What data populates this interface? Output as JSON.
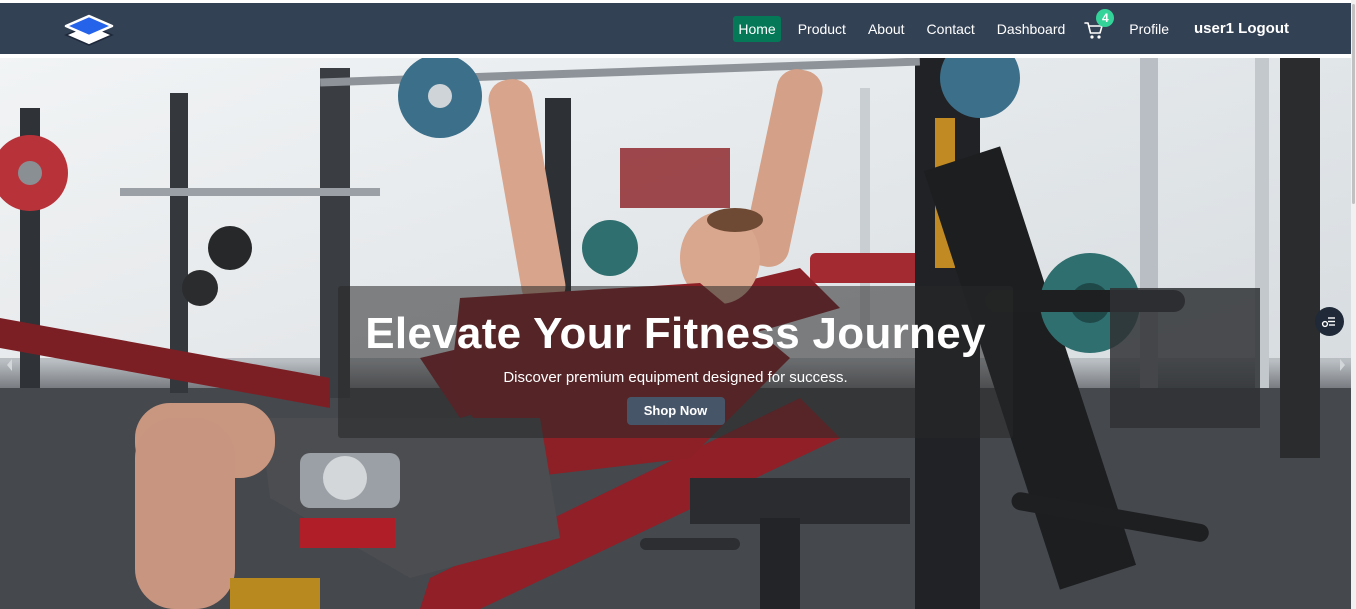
{
  "navbar": {
    "logo_icon": "layers-stack-icon",
    "links": [
      {
        "label": "Home",
        "active": true
      },
      {
        "label": "Product",
        "active": false
      },
      {
        "label": "About",
        "active": false
      },
      {
        "label": "Contact",
        "active": false
      },
      {
        "label": "Dashboard",
        "active": false
      }
    ],
    "cart_icon": "shopping-cart-icon",
    "cart_count": "4",
    "profile_label": "Profile",
    "user_logout_label": "user1 Logout"
  },
  "hero": {
    "title": "Elevate Your Fitness Journey",
    "subtitle": "Discover premium equipment designed for success.",
    "cta_label": "Shop Now",
    "prev_icon": "chevron-left-icon",
    "next_icon": "chevron-right-icon",
    "fab_icon": "filter-list-icon"
  },
  "colors": {
    "navbar_bg": "#334155",
    "active_link_bg": "#047857",
    "badge_bg": "#34d399",
    "cta_bg": "#475569"
  }
}
